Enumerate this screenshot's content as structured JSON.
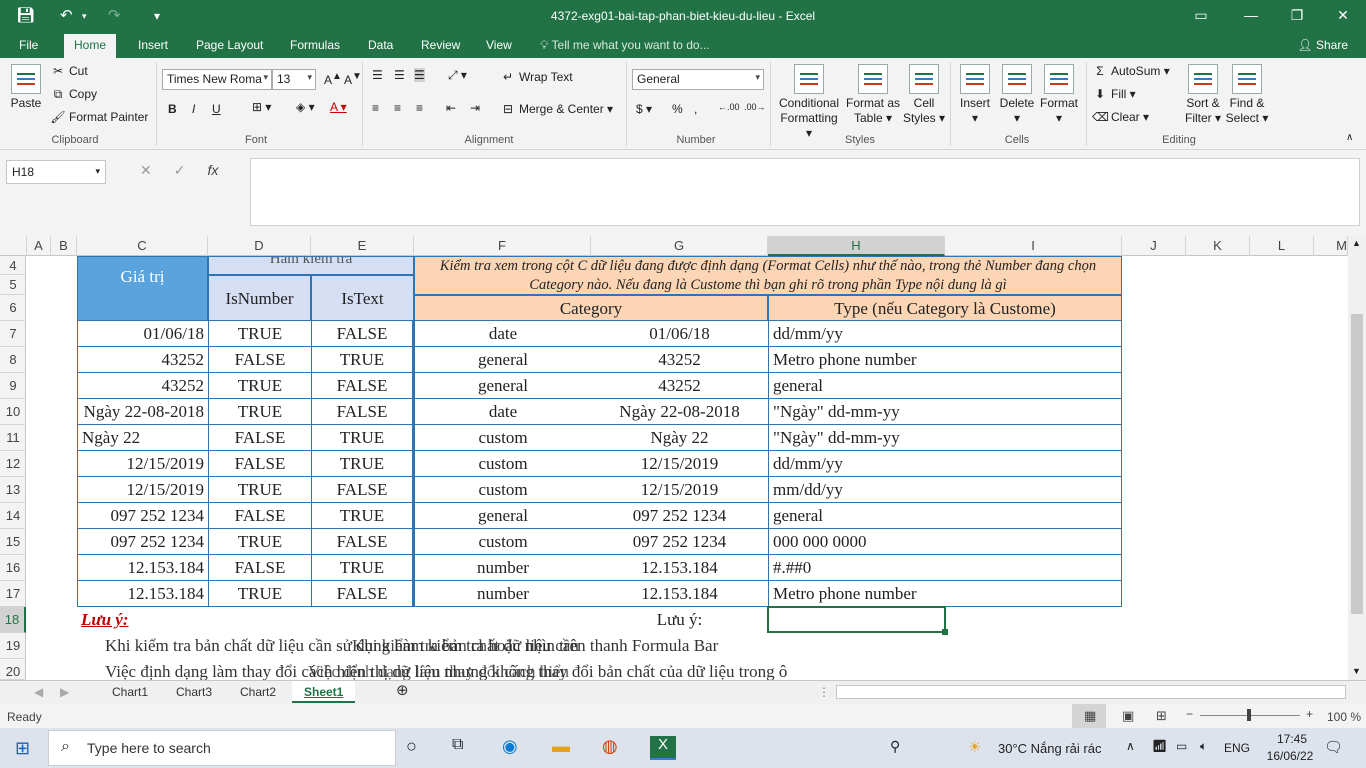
{
  "window": {
    "title": "4372-exg01-bai-tap-phan-biet-kieu-du-lieu - Excel",
    "save_icon": "save-icon",
    "colors": {
      "excel_green": "#217346",
      "header_blue": "#5ba3dc",
      "header_lavender": "#d5def2",
      "header_peach": "#fcd5b4",
      "border_blue": "#2e75b6"
    }
  },
  "ribbon_tabs": [
    "File",
    "Home",
    "Insert",
    "Page Layout",
    "Formulas",
    "Data",
    "Review",
    "View"
  ],
  "tell_me": "Tell me what you want to do...",
  "share": "Share",
  "ribbon": {
    "clipboard": {
      "paste": "Paste",
      "cut": "Cut",
      "copy": "Copy",
      "format_painter": "Format Painter",
      "label": "Clipboard"
    },
    "font": {
      "name": "Times New Roma",
      "size": "13",
      "bold": "B",
      "italic": "I",
      "underline": "U",
      "label": "Font"
    },
    "alignment": {
      "wrap": "Wrap Text",
      "merge": "Merge & Center",
      "label": "Alignment"
    },
    "number": {
      "format": "General",
      "percent": "%",
      "label": "Number"
    },
    "styles": {
      "conditional": [
        "Conditional",
        "Formatting"
      ],
      "format_table": [
        "Format as",
        "Table"
      ],
      "cell_styles": [
        "Cell",
        "Styles"
      ],
      "label": "Styles"
    },
    "cells": {
      "insert": "Insert",
      "delete": "Delete",
      "format": "Format",
      "label": "Cells"
    },
    "editing": {
      "autosum": "AutoSum",
      "fill": "Fill",
      "clear": "Clear",
      "sort": [
        "Sort &",
        "Filter"
      ],
      "find": [
        "Find &",
        "Select"
      ],
      "label": "Editing"
    }
  },
  "formula_bar": {
    "name_box": "H18",
    "cancel": "✕",
    "enter": "✓",
    "fx": "fx",
    "value": ""
  },
  "columns": [
    "A",
    "B",
    "C",
    "D",
    "E",
    "F",
    "G",
    "H",
    "I",
    "J",
    "K",
    "L",
    "M"
  ],
  "rows": [
    "4",
    "5",
    "6",
    "7",
    "8",
    "9",
    "10",
    "11",
    "12",
    "13",
    "14",
    "15",
    "16",
    "17",
    "18",
    "19",
    "20"
  ],
  "sheet": {
    "hdr_value": "Giá trị",
    "hdr_func": "Hàm kiểm tra",
    "hdr_isnumber": "IsNumber",
    "hdr_istext": "IsText",
    "hdr_note": "Kiểm tra xem trong cột C dữ liệu đang được định dạng (Format Cells) như thế nào, trong thẻ Number đang chọn Category nào. Nếu đang là Custome thì bạn ghi rõ trong phần Type nội dung là gì",
    "hdr_category": "Category",
    "hdr_type": "Type (nếu Category là Custome)",
    "data": [
      {
        "value": "01/06/18",
        "isnum": "TRUE",
        "istext": "FALSE",
        "cat": "date",
        "shown": "01/06/18",
        "type": "dd/mm/yy",
        "align": "r"
      },
      {
        "value": "43252",
        "isnum": "FALSE",
        "istext": "TRUE",
        "cat": "general",
        "shown": "43252",
        "type": "Metro phone number",
        "align": "r"
      },
      {
        "value": "43252",
        "isnum": "TRUE",
        "istext": "FALSE",
        "cat": "general",
        "shown": "43252",
        "type": "general",
        "align": "r"
      },
      {
        "value": "Ngày 22-08-2018",
        "isnum": "TRUE",
        "istext": "FALSE",
        "cat": "date",
        "shown": "Ngày 22-08-2018",
        "type": "\"Ngày\" dd-mm-yy",
        "align": "r"
      },
      {
        "value": "Ngày 22",
        "isnum": "FALSE",
        "istext": "TRUE",
        "cat": "custom",
        "shown": "Ngày 22",
        "type": "\"Ngày\" dd-mm-yy",
        "align": "l"
      },
      {
        "value": "12/15/2019",
        "isnum": "FALSE",
        "istext": "TRUE",
        "cat": "custom",
        "shown": "12/15/2019",
        "type": "dd/mm/yy",
        "align": "r"
      },
      {
        "value": "12/15/2019",
        "isnum": "TRUE",
        "istext": "FALSE",
        "cat": "custom",
        "shown": "12/15/2019",
        "type": "mm/dd/yy",
        "align": "r"
      },
      {
        "value": "097 252 1234",
        "isnum": "FALSE",
        "istext": "TRUE",
        "cat": "general",
        "shown": "097 252 1234",
        "type": "general",
        "align": "r"
      },
      {
        "value": "097 252 1234",
        "isnum": "TRUE",
        "istext": "FALSE",
        "cat": "custom",
        "shown": "097 252 1234",
        "type": "000 000 0000",
        "align": "r"
      },
      {
        "value": "12.153.184",
        "isnum": "FALSE",
        "istext": "TRUE",
        "cat": "number",
        "shown": "12.153.184",
        "type": "#.##0",
        "align": "r"
      },
      {
        "value": "12.153.184",
        "isnum": "TRUE",
        "istext": "FALSE",
        "cat": "number",
        "shown": "12.153.184",
        "type": "Metro phone number",
        "align": "r"
      }
    ],
    "note_label": "Lưu ý:",
    "note_label_g": "Lưu ý:",
    "note_line1": "Khi kiểm tra bản chất dữ liệu cần sử dụng hàm kiểm tra hoặc nhìn trên thanh Formula Bar",
    "note_line1_overlap": "Khi kiểm tra bản chất dữ liệu cần",
    "note_line2": "Việc định dạng làm thay đổi cách hiển thị dữ liệu nhưng không thay đổi bản chất của dữ liệu trong ô",
    "note_line2_overlap": "Việc định dạng làm thay đổi cách hiển"
  },
  "sheet_tabs": [
    "Chart1",
    "Chart3",
    "Chart2",
    "Sheet1"
  ],
  "active_sheet": "Sheet1",
  "status": {
    "ready": "Ready",
    "zoom": "100 %"
  },
  "taskbar": {
    "search_placeholder": "Type here to search",
    "weather": "30°C  Nắng rải rác",
    "lang": "ENG",
    "time": "17:45",
    "date": "16/06/22"
  }
}
